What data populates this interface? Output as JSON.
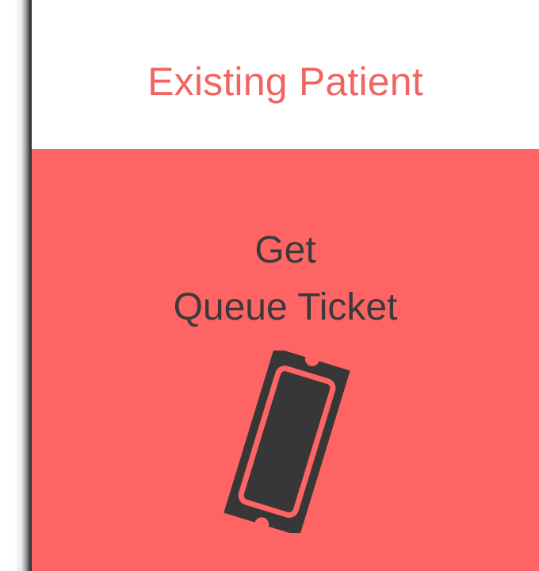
{
  "header": {
    "title": "Existing Patient"
  },
  "queue_button": {
    "line1": "Get",
    "line2": "Queue Ticket",
    "icon": "ticket-icon"
  },
  "colors": {
    "brand_coral": "#fe6464",
    "title_coral": "#f06563",
    "text_dark": "#3a3a3a"
  }
}
